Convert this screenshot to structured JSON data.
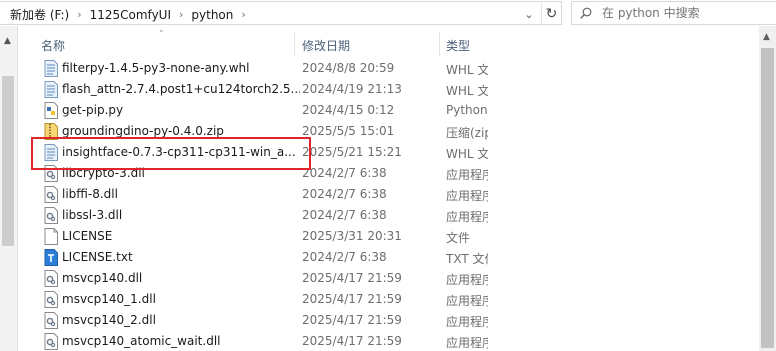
{
  "address": {
    "crumbs": [
      "新加卷 (F:)",
      "1125ComfyUI",
      "python"
    ],
    "separator": "›",
    "dropdown_glyph": "⌄",
    "refresh_glyph": "↻"
  },
  "search": {
    "placeholder": "在 python 中搜索"
  },
  "columns": {
    "name": "名称",
    "date": "修改日期",
    "type": "类型",
    "sort_glyph": "˄"
  },
  "files": [
    {
      "name": "filterpy-1.4.5-py3-none-any.whl",
      "date": "2024/8/8 20:59",
      "type": "WHL 文件",
      "icon": "whl-file-icon"
    },
    {
      "name": "flash_attn-2.7.4.post1+cu124torch2.5....",
      "date": "2024/4/19 21:13",
      "type": "WHL 文件",
      "icon": "whl-file-icon"
    },
    {
      "name": "get-pip.py",
      "date": "2024/4/15 0:12",
      "type": "Python File",
      "icon": "python-file-icon"
    },
    {
      "name": "groundingdino-py-0.4.0.zip",
      "date": "2025/5/5 15:01",
      "type": "压缩(zipped)",
      "icon": "zip-file-icon"
    },
    {
      "name": "insightface-0.7.3-cp311-cp311-win_a...",
      "date": "2025/5/21 15:21",
      "type": "WHL 文件",
      "icon": "whl-file-icon"
    },
    {
      "name": "libcrypto-3.dll",
      "date": "2024/2/7 6:38",
      "type": "应用程序扩展",
      "icon": "dll-file-icon"
    },
    {
      "name": "libffi-8.dll",
      "date": "2024/2/7 6:38",
      "type": "应用程序扩展",
      "icon": "dll-file-icon"
    },
    {
      "name": "libssl-3.dll",
      "date": "2024/2/7 6:38",
      "type": "应用程序扩展",
      "icon": "dll-file-icon"
    },
    {
      "name": "LICENSE",
      "date": "2025/3/31 20:31",
      "type": "文件",
      "icon": "blank-file-icon"
    },
    {
      "name": "LICENSE.txt",
      "date": "2024/2/7 6:38",
      "type": "TXT 文件",
      "icon": "txt-file-icon"
    },
    {
      "name": "msvcp140.dll",
      "date": "2025/4/17 21:59",
      "type": "应用程序扩展",
      "icon": "dll-file-icon"
    },
    {
      "name": "msvcp140_1.dll",
      "date": "2025/4/17 21:59",
      "type": "应用程序扩展",
      "icon": "dll-file-icon"
    },
    {
      "name": "msvcp140_2.dll",
      "date": "2025/4/17 21:59",
      "type": "应用程序扩展",
      "icon": "dll-file-icon"
    },
    {
      "name": "msvcp140_atomic_wait.dll",
      "date": "2025/4/17 21:59",
      "type": "应用程序扩展",
      "icon": "dll-file-icon"
    }
  ],
  "highlight_color": "#e0262b"
}
